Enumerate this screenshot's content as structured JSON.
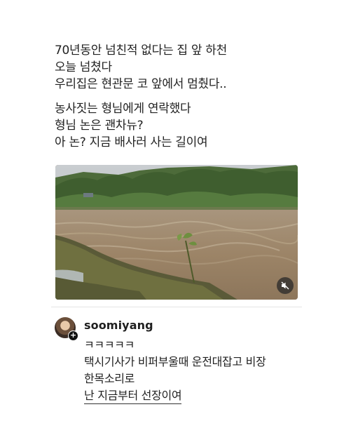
{
  "post": {
    "paragraph1": [
      "70년동안 넘친적 없다는 집 앞 하천",
      "오늘 넘쳤다",
      "우리집은 현관문 코 앞에서 멈췄다.."
    ],
    "paragraph2": [
      "농사짓는 형님에게 연락했다",
      "형님 논은 괜차뉴?",
      "아 논? 지금 배사러 사는 길이여"
    ],
    "media": {
      "icon": "mute-icon"
    }
  },
  "comment": {
    "username": "soomiyang",
    "lines": [
      "ㅋㅋㅋㅋㅋ",
      "택시기사가 비퍼부울때 운전대잡고 비장",
      "한목소리로",
      "난 지금부터 선장이여"
    ]
  },
  "colors": {
    "text": "#222222",
    "divider": "#e4e4e4",
    "background": "#ffffff"
  }
}
